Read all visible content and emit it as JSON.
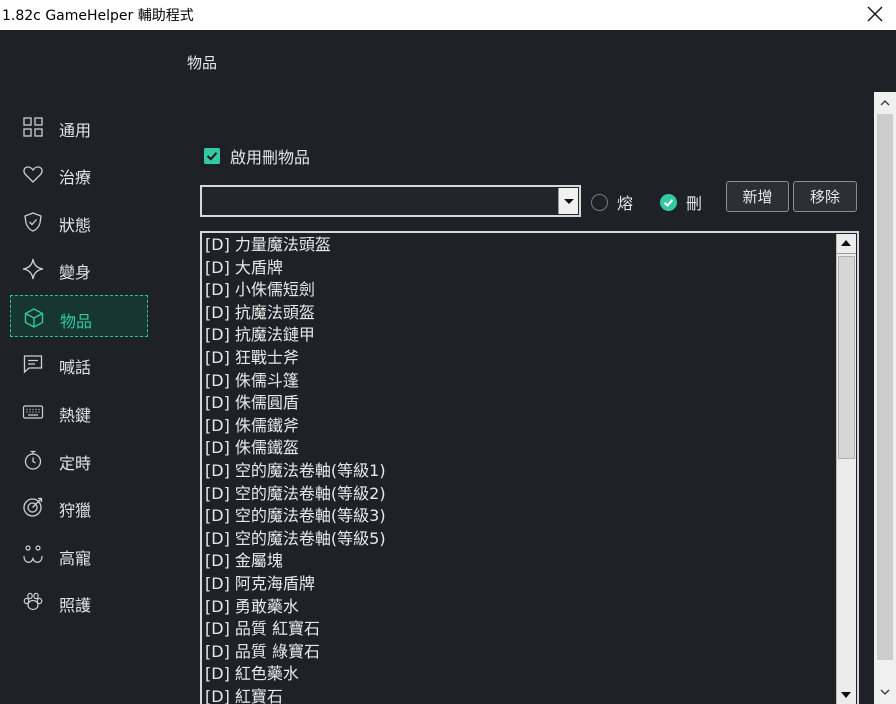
{
  "window": {
    "title": "1.82c GameHelper 輔助程式"
  },
  "page": {
    "title": "物品"
  },
  "sidebar": {
    "items": [
      {
        "label": "通用",
        "icon": "grid-icon"
      },
      {
        "label": "治療",
        "icon": "heart-icon"
      },
      {
        "label": "狀態",
        "icon": "shield-icon"
      },
      {
        "label": "變身",
        "icon": "sparkle-icon"
      },
      {
        "label": "物品",
        "icon": "cube-icon",
        "active": true
      },
      {
        "label": "喊話",
        "icon": "chat-icon"
      },
      {
        "label": "熱鍵",
        "icon": "keyboard-icon"
      },
      {
        "label": "定時",
        "icon": "stopwatch-icon"
      },
      {
        "label": "狩獵",
        "icon": "target-icon"
      },
      {
        "label": "高寵",
        "icon": "pet-face-icon"
      },
      {
        "label": "照護",
        "icon": "paw-icon"
      }
    ]
  },
  "items_panel": {
    "enable_label": "啟用刪物品",
    "enable_checked": true,
    "combo_value": "",
    "radio_smelt_label": "熔",
    "radio_delete_label": "刪",
    "selected_mode": "刪",
    "add_label": "新增",
    "remove_label": "移除",
    "list": [
      "[D] 力量魔法頭盔",
      "[D] 大盾牌",
      "[D] 小侏儒短劍",
      "[D] 抗魔法頭盔",
      "[D] 抗魔法鏈甲",
      "[D] 狂戰士斧",
      "[D] 侏儒斗篷",
      "[D] 侏儒圓盾",
      "[D] 侏儒鐵斧",
      "[D] 侏儒鐵盔",
      "[D] 空的魔法卷軸(等級1)",
      "[D] 空的魔法卷軸(等級2)",
      "[D] 空的魔法卷軸(等級3)",
      "[D] 空的魔法卷軸(等級5)",
      "[D] 金屬塊",
      "[D] 阿克海盾牌",
      "[D] 勇敢藥水",
      "[D] 品質 紅寶石",
      "[D] 品質 綠寶石",
      "[D] 紅色藥水",
      "[D] 紅寶石"
    ]
  },
  "colors": {
    "accent": "#33c9a4",
    "background": "#1e2226",
    "active_bg": "#17362f"
  }
}
